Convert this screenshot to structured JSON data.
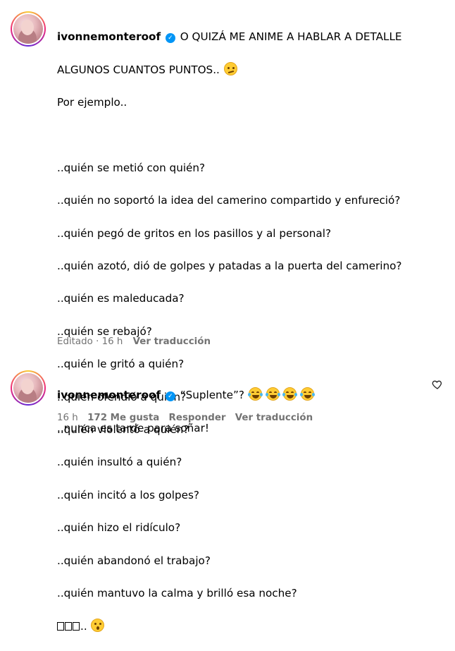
{
  "comments": [
    {
      "username": "ivonnemonteroof",
      "first_line": "O QUIZÁ ME ANIME A HABLAR A DETALLE",
      "second_line": "ALGUNOS CUANTOS PUNTOS..",
      "intro": "Por ejemplo..",
      "questions": [
        "..quién se metió con quién?",
        "..quién no soportó la idea del camerino compartido y enfureció?",
        "..quién pegó de gritos en los pasillos y al personal?",
        "..quién azotó, dió de golpes y patadas a la puerta del camerino?",
        "..quién es maleducada?",
        "..quién se rebajó?",
        "..quién le gritó a quién?",
        "..quién ofendió a quién?",
        "..quién violentó a quién?",
        "..quién insultó a quién?",
        "..quién incitó a los golpes?",
        "..quién hizo el ridículo?",
        "..quién abandonó el trabajo?",
        "..quién mantuvo la calma y brilló esa noche?"
      ],
      "last_line_suffix": "..",
      "meta": {
        "edited": "Editado · 16 h",
        "translate": "Ver traducción"
      },
      "icons": {
        "inline_emoji_1": "thinking-face-emoji",
        "inline_emoji_2": "hushed-face-emoji",
        "placeholder_glyphs": "missing-glyph-boxes"
      }
    },
    {
      "username": "ivonnemonteroof",
      "text": "“Suplente”?",
      "second_line": "..nunca es tarde para soñar!",
      "meta": {
        "time": "16 h",
        "likes": "172 Me gusta",
        "reply": "Responder",
        "translate": "Ver traducción"
      },
      "icons": {
        "emojis": [
          "laughing-tears-emoji",
          "laughing-tears-emoji",
          "laughing-tears-emoji",
          "laughing-tears-emoji"
        ],
        "like": "heart-icon"
      }
    }
  ],
  "colors": {
    "verified": "#0095f6",
    "meta_text": "#737373"
  }
}
